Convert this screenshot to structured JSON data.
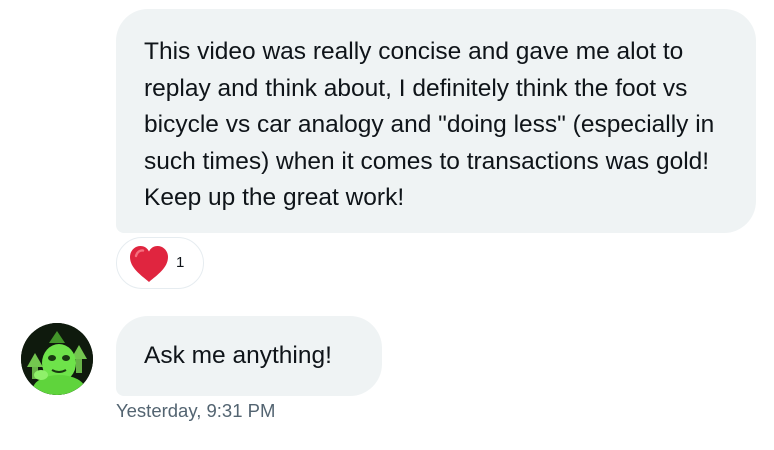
{
  "conversation": {
    "messages": [
      {
        "text": "This video was really concise and gave me alot to replay and think about, I definitely think the foot vs bicycle vs car analogy and \"doing less\" (especially in such times) when it comes to transactions was gold! Keep up the great work!",
        "reaction": {
          "icon": "heart-icon",
          "count": "1"
        }
      },
      {
        "text": "Ask me anything!",
        "timestamp": "Yesterday, 9:31 PM"
      }
    ]
  },
  "colors": {
    "bubble_background": "#eff3f4",
    "text": "#0f1419",
    "secondary_text": "#536471",
    "heart": "#e0253f"
  }
}
